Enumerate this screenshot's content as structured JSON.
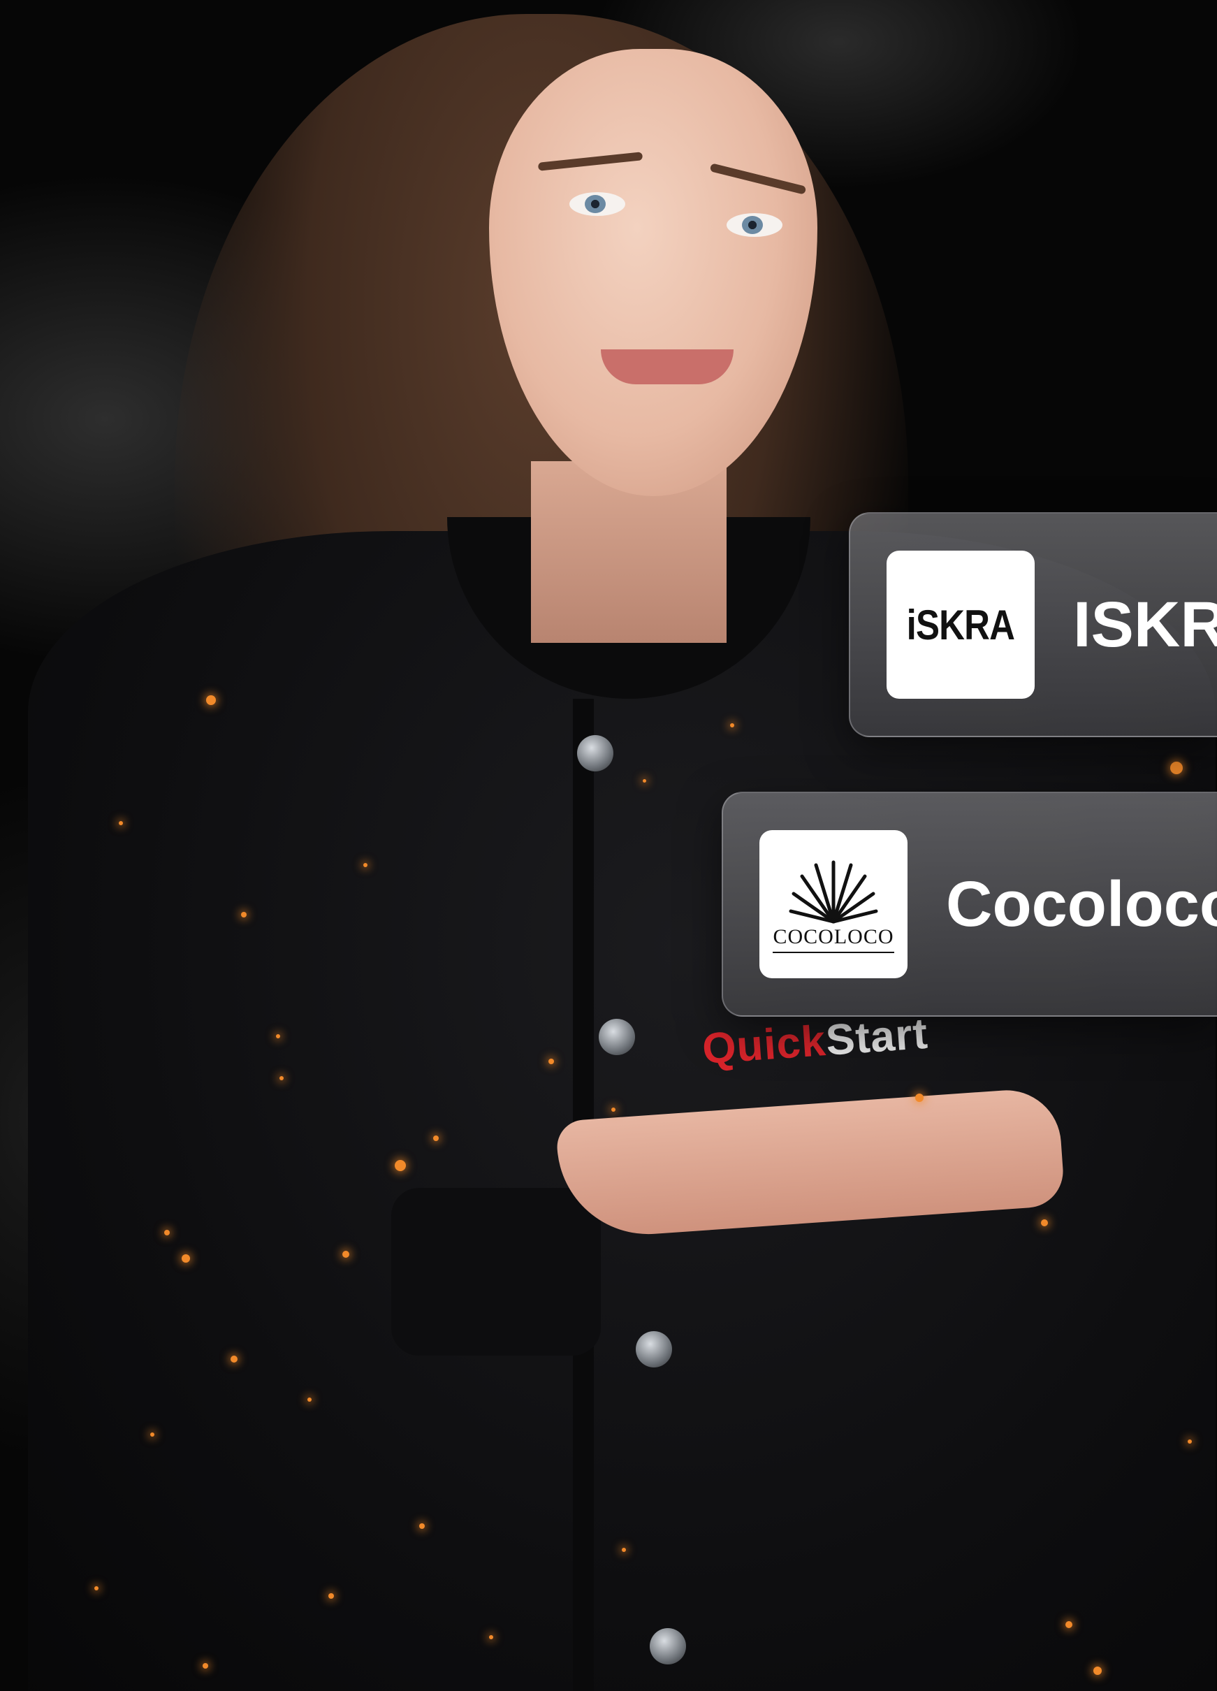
{
  "photo": {
    "description_icon": "woman-presenting-icon"
  },
  "jacket_branding": {
    "part_red": "Quick",
    "part_white": "Start",
    "red_color": "#d9242b"
  },
  "cards": [
    {
      "logo_text": "iSKRA",
      "label": "ISKRA"
    },
    {
      "logo_text": "COCOLOCO",
      "label": "Cocoloco"
    }
  ],
  "colors": {
    "spark": "#f28a2a",
    "card_background": "#6e6e72"
  }
}
